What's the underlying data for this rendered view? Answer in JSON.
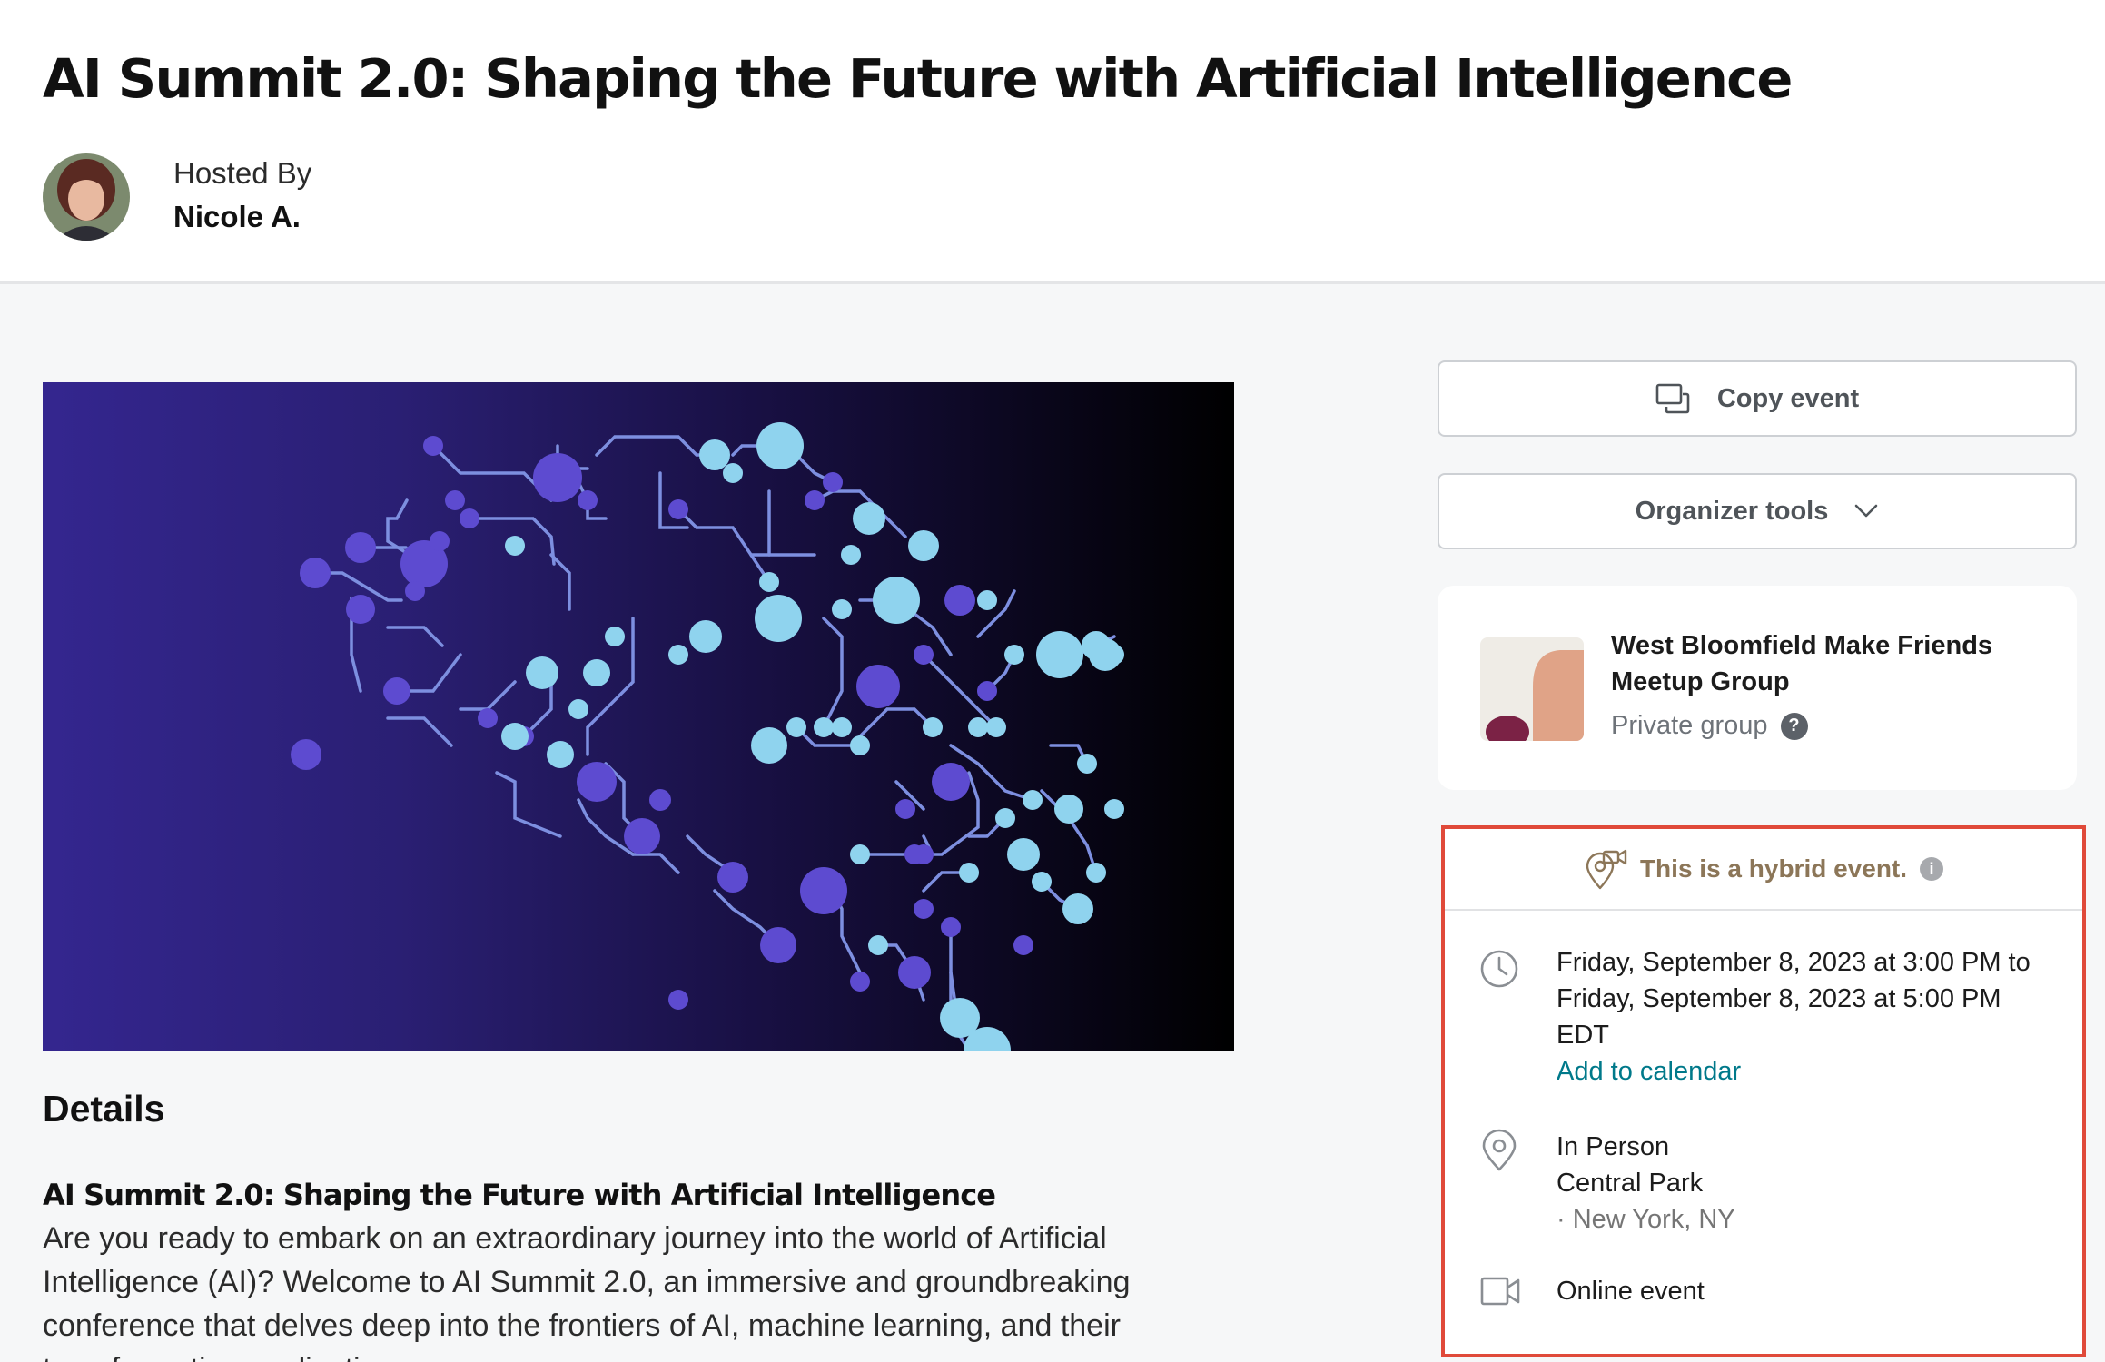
{
  "event": {
    "title": "AI Summit 2.0: Shaping the Future with Artificial Intelligence",
    "host_label": "Hosted By",
    "host_name": "Nicole A."
  },
  "details": {
    "heading": "Details",
    "subtitle": "AI Summit 2.0: Shaping the Future with Artificial Intelligence",
    "body": "Are you ready to embark on an extraordinary journey into the world of Artificial Intelligence (AI)? Welcome to AI Summit 2.0, an immersive and groundbreaking conference that delves deep into the frontiers of AI, machine learning, and their transformative applications."
  },
  "sidebar": {
    "copy_event_label": "Copy event",
    "organizer_tools_label": "Organizer tools",
    "group": {
      "name": "West Bloomfield Make Friends Meetup Group",
      "privacy": "Private group",
      "help_glyph": "?"
    },
    "event_info": {
      "hybrid_notice": "This is a hybrid event.",
      "info_glyph": "i",
      "time_text": "Friday, September 8, 2023 at 3:00 PM to Friday, September 8, 2023 at 5:00 PM EDT",
      "add_to_calendar": "Add to calendar",
      "location_type": "In Person",
      "venue": "Central Park",
      "city": "· New York, NY",
      "online_label": "Online event"
    }
  },
  "icons": {
    "copy": "copy-icon",
    "chevron": "chevron-down-icon",
    "hybrid": "hybrid-location-icon",
    "clock": "clock-icon",
    "pin": "location-pin-icon",
    "video": "video-camera-icon",
    "help": "help-icon",
    "info": "info-icon"
  },
  "colors": {
    "accent_link": "#00798a",
    "highlight_border": "#e04a3a",
    "hybrid_text": "#8c7658",
    "banner_left": "#34268f",
    "banner_right": "#000000"
  }
}
